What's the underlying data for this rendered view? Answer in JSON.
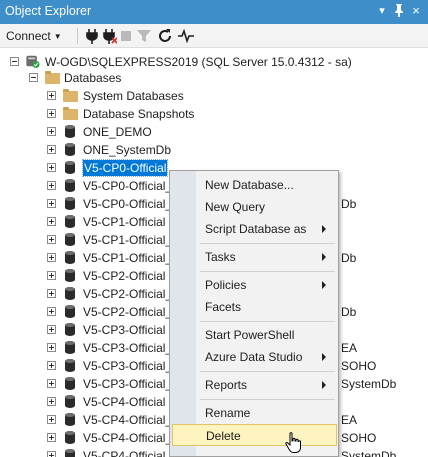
{
  "window": {
    "title": "Object Explorer",
    "controls": {
      "pin_dropdown": "▾",
      "pin": "⊣",
      "close": "×"
    }
  },
  "toolbar": {
    "connect_label": "Connect",
    "tools": [
      "connect-plug-icon",
      "disconnect-plug-icon",
      "stop-icon",
      "filter-icon",
      "refresh-icon",
      "activity-monitor-icon"
    ]
  },
  "tree": {
    "server": "W-OGD\\SQLEXPRESS2019 (SQL Server 15.0.4312 - sa)",
    "databases_label": "Databases",
    "items": [
      {
        "label": "System Databases",
        "icon": "folder-icon"
      },
      {
        "label": "Database Snapshots",
        "icon": "folder-icon"
      },
      {
        "label": "ONE_DEMO",
        "icon": "database-icon"
      },
      {
        "label": "ONE_SystemDb",
        "icon": "database-icon"
      },
      {
        "label": "V5-CP0-Official",
        "icon": "database-icon",
        "selected": true
      },
      {
        "label": "V5-CP0-Official_",
        "icon": "database-icon"
      },
      {
        "label": "V5-CP0-Official_",
        "suffix": "Db",
        "icon": "database-icon"
      },
      {
        "label": "V5-CP1-Official",
        "icon": "database-icon"
      },
      {
        "label": "V5-CP1-Official_",
        "icon": "database-icon"
      },
      {
        "label": "V5-CP1-Official_",
        "suffix": "Db",
        "icon": "database-icon"
      },
      {
        "label": "V5-CP2-Official",
        "icon": "database-icon"
      },
      {
        "label": "V5-CP2-Official_",
        "icon": "database-icon"
      },
      {
        "label": "V5-CP2-Official_",
        "suffix": "Db",
        "icon": "database-icon"
      },
      {
        "label": "V5-CP3-Official",
        "icon": "database-icon"
      },
      {
        "label": "V5-CP3-Official_",
        "suffix": "EA",
        "icon": "database-icon"
      },
      {
        "label": "V5-CP3-Official_",
        "suffix": "SOHO",
        "icon": "database-icon"
      },
      {
        "label": "V5-CP3-Official_",
        "suffix": "SystemDb",
        "icon": "database-icon"
      },
      {
        "label": "V5-CP4-Official",
        "icon": "database-icon"
      },
      {
        "label": "V5-CP4-Official_",
        "suffix": "EA",
        "icon": "database-icon"
      },
      {
        "label": "V5-CP4-Official_",
        "suffix": "SOHO",
        "icon": "database-icon"
      },
      {
        "label": "V5-CP4-Official_",
        "suffix": "SystemDb",
        "icon": "database-icon"
      }
    ]
  },
  "context_menu": {
    "items": [
      {
        "label": "New Database...",
        "submenu": false
      },
      {
        "label": "New Query",
        "submenu": false
      },
      {
        "label": "Script Database as",
        "submenu": true
      },
      {
        "separator": true
      },
      {
        "label": "Tasks",
        "submenu": true
      },
      {
        "separator": true
      },
      {
        "label": "Policies",
        "submenu": true
      },
      {
        "label": "Facets",
        "submenu": false
      },
      {
        "separator": true
      },
      {
        "label": "Start PowerShell",
        "submenu": false
      },
      {
        "label": "Azure Data Studio",
        "submenu": true
      },
      {
        "separator": true
      },
      {
        "label": "Reports",
        "submenu": true
      },
      {
        "separator": true
      },
      {
        "label": "Rename",
        "submenu": false
      },
      {
        "label": "Delete",
        "submenu": false,
        "highlighted": true
      }
    ]
  },
  "colors": {
    "titlebar": "#3d8ec9",
    "selection": "#0078d7",
    "menu_highlight": "#fdf4bf",
    "menu_highlight_border": "#e5c365"
  }
}
